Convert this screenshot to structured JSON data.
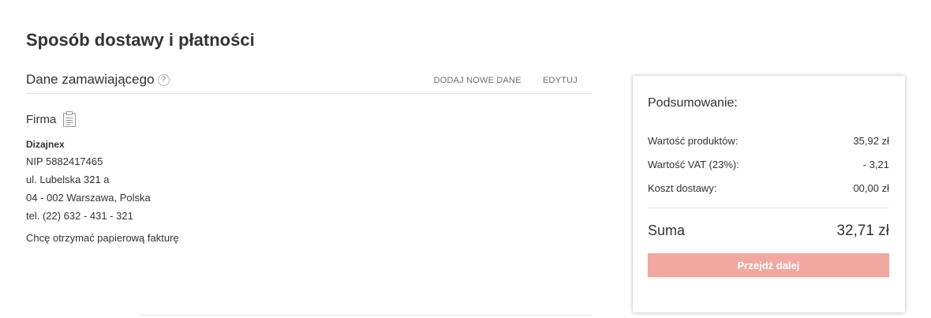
{
  "page": {
    "title": "Sposób dostawy i płatności"
  },
  "orderer": {
    "title": "Dane zamawiającego",
    "help_icon": "?",
    "actions": {
      "add_new": "DODAJ NOWE DANE",
      "edit": "EDYTUJ"
    }
  },
  "company": {
    "label": "Firma",
    "name": "Dizajnex",
    "nip": "NIP 5882417465",
    "street": "ul. Lubelska 321 a",
    "city": "04 - 002 Warszawa, Polska",
    "phone": "tel. (22) 632 - 431 - 321",
    "invoice_note": "Chcę otrzymać papierową fakturę"
  },
  "summary": {
    "title": "Podsumowanie:",
    "rows": [
      {
        "label": "Wartość produktów:",
        "value": "35,92 zł"
      },
      {
        "label": "Wartość VAT (23%):",
        "value": "- 3,21"
      },
      {
        "label": "Koszt dostawy:",
        "value": "00,00 zł"
      }
    ],
    "total_label": "Suma",
    "total_value": "32,71 zł",
    "button_label": "Przejdź dalej"
  },
  "colors": {
    "button_bg": "#f0a8a0",
    "text": "#333333",
    "muted": "#6f6f6f"
  }
}
